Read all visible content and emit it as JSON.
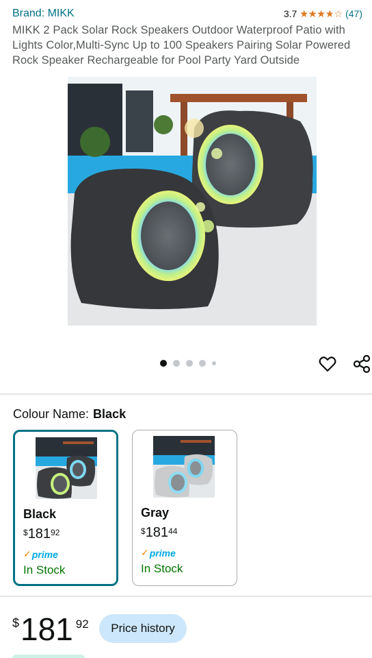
{
  "header": {
    "brand": "Brand: MIKK",
    "rating_value": "3.7",
    "rating_fraction": 0.74,
    "rating_count": "(47)"
  },
  "product": {
    "title": "MIKK 2 Pack Solar Rock Speakers Outdoor Waterproof Patio with Lights Color,Multi-Sync Up to 100 Speakers Pairing Solar Powered Rock Speaker Rechargeable for Pool Party Yard Outside"
  },
  "gallery": {
    "image_count": 5,
    "active_index": 0
  },
  "icons": {
    "wishlist": "heart-icon",
    "share": "share-icon",
    "stars": "star-rating-icon",
    "prime_check": "checkmark-icon"
  },
  "colour": {
    "label": "Colour Name:",
    "selected": "Black"
  },
  "swatches": [
    {
      "name": "Black",
      "currency": "$",
      "price_whole": "181",
      "price_cents": "92",
      "prime_check": "✓",
      "prime_label": "prime",
      "stock": "In Stock",
      "rock_color": "#3b3d40"
    },
    {
      "name": "Gray",
      "currency": "$",
      "price_whole": "181",
      "price_cents": "44",
      "prime_check": "✓",
      "prime_label": "prime",
      "stock": "In Stock",
      "rock_color": "#c9cbcc"
    }
  ],
  "price": {
    "currency": "$",
    "whole": "181",
    "cents": "92",
    "history_button": "Price history"
  },
  "colors": {
    "link": "#007185",
    "star": "#de7921",
    "prime": "#00a8e1",
    "in_stock": "#007600",
    "selected_border": "#007185",
    "pill": "#cce7fb"
  }
}
